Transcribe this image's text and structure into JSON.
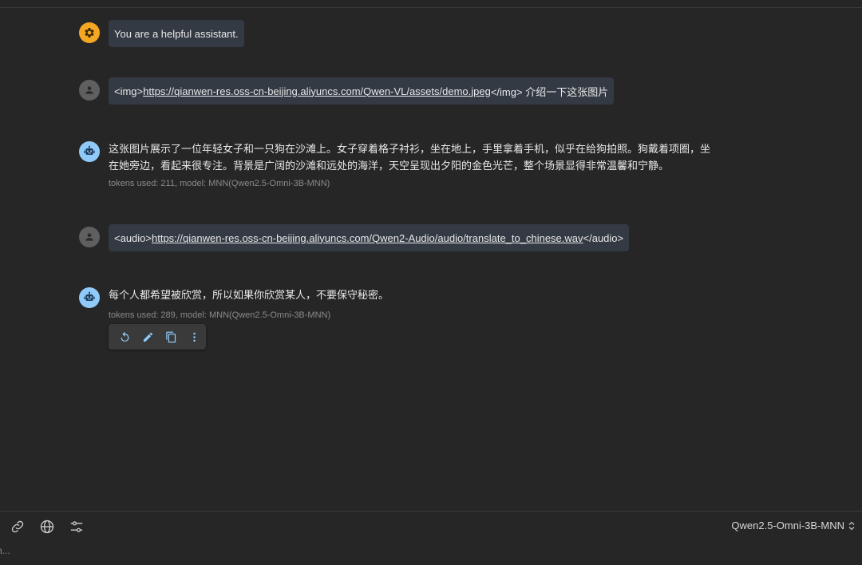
{
  "messages": {
    "system": {
      "text": "You are a helpful assistant."
    },
    "user1": {
      "prefix": "<img>",
      "link": "https://qianwen-res.oss-cn-beijing.aliyuncs.com/Qwen-VL/assets/demo.jpeg",
      "suffix": "</img> 介绍一下这张图片"
    },
    "bot1": {
      "line1": "这张图片展示了一位年轻女子和一只狗在沙滩上。女子穿着格子衬衫，坐在地上，手里拿着手机，似乎在给狗拍照。狗戴着项圈，坐",
      "line2": "在她旁边，看起来很专注。背景是广阔的沙滩和远处的海洋，天空呈现出夕阳的金色光芒，整个场景显得非常温馨和宁静。",
      "meta": "tokens used: 211, model: MNN(Qwen2.5-Omni-3B-MNN)"
    },
    "user2": {
      "prefix": "<audio>",
      "link": "https://qianwen-res.oss-cn-beijing.aliyuncs.com/Qwen2-Audio/audio/translate_to_chinese.wav",
      "suffix": "</audio>"
    },
    "bot2": {
      "text": "每个人都希望被欣赏，所以如果你欣赏某人，不要保守秘密。",
      "meta": "tokens used: 289, model: MNN(Qwen2.5-Omni-3B-MNN)"
    }
  },
  "bottom": {
    "model": "Qwen2.5-Omni-3B-MNN",
    "input_placeholder": "n..."
  },
  "icons": {
    "system_avatar": "gear-icon",
    "user_avatar": "person-icon",
    "bot_avatar": "robot-icon",
    "actions": [
      "regenerate-icon",
      "edit-icon",
      "copy-icon",
      "more-vert-icon"
    ],
    "tools": [
      "link-icon",
      "globe-icon",
      "sliders-icon"
    ]
  },
  "colors": {
    "background": "#262626",
    "bubble": "#333a44",
    "system_avatar": "#f5a623",
    "bot_avatar": "#90caf9",
    "user_avatar": "#5f5f5f",
    "action_icon": "#90caf9"
  }
}
